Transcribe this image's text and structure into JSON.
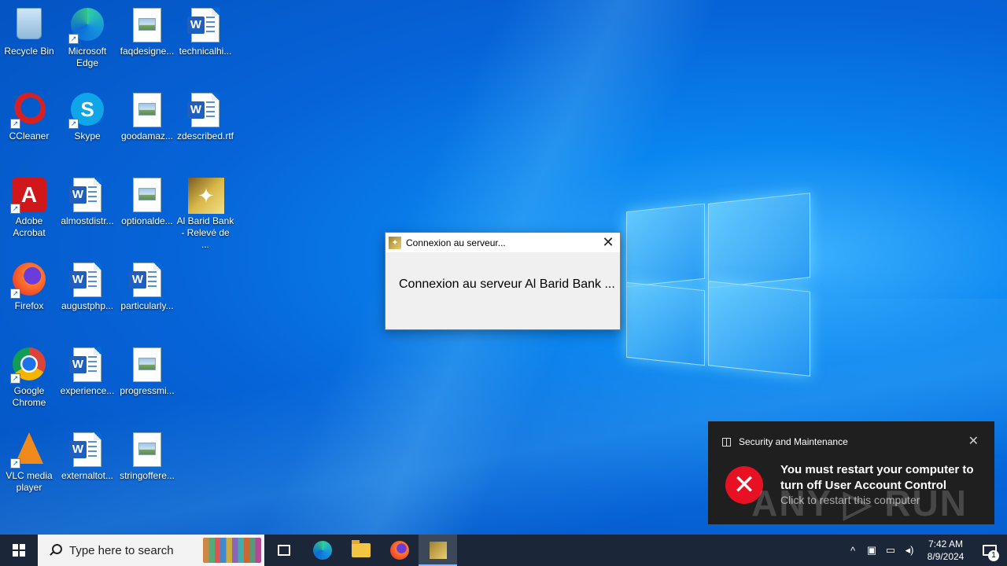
{
  "desktop": {
    "icons": [
      {
        "label": "Recycle Bin"
      },
      {
        "label": "Microsoft Edge"
      },
      {
        "label": "faqdesigne..."
      },
      {
        "label": "technicalhi..."
      },
      {
        "label": "CCleaner"
      },
      {
        "label": "Skype"
      },
      {
        "label": "goodamaz..."
      },
      {
        "label": "zdescribed.rtf"
      },
      {
        "label": "Adobe Acrobat"
      },
      {
        "label": "almostdistr..."
      },
      {
        "label": "optionalde..."
      },
      {
        "label": "Al Barid Bank - Relevé de ..."
      },
      {
        "label": "Firefox"
      },
      {
        "label": "augustphp..."
      },
      {
        "label": "particularly..."
      },
      {
        "label": "Google Chrome"
      },
      {
        "label": "experience..."
      },
      {
        "label": "progressmi..."
      },
      {
        "label": "VLC media player"
      },
      {
        "label": "externaltot..."
      },
      {
        "label": "stringoffere..."
      }
    ]
  },
  "dialog": {
    "title": "Connexion au serveur...",
    "message": "Connexion au serveur Al Barid Bank ...",
    "close_glyph": "✕"
  },
  "toast": {
    "source": "Security and Maintenance",
    "title": "You must restart your computer to turn off User Account Control",
    "subtitle": "Click to restart this computer",
    "close_glyph": "✕",
    "error_glyph": "✕",
    "watermark": "ANY ▷ RUN"
  },
  "taskbar": {
    "search_placeholder": "Type here to search",
    "time": "7:42 AM",
    "date": "8/9/2024",
    "notification_count": "1",
    "tray_chevron": "^"
  },
  "colors": {
    "accent": "#0a86f0",
    "toast_bg": "#1f1f1f",
    "error_red": "#e81123",
    "taskbar_bg": "#1b2638"
  }
}
